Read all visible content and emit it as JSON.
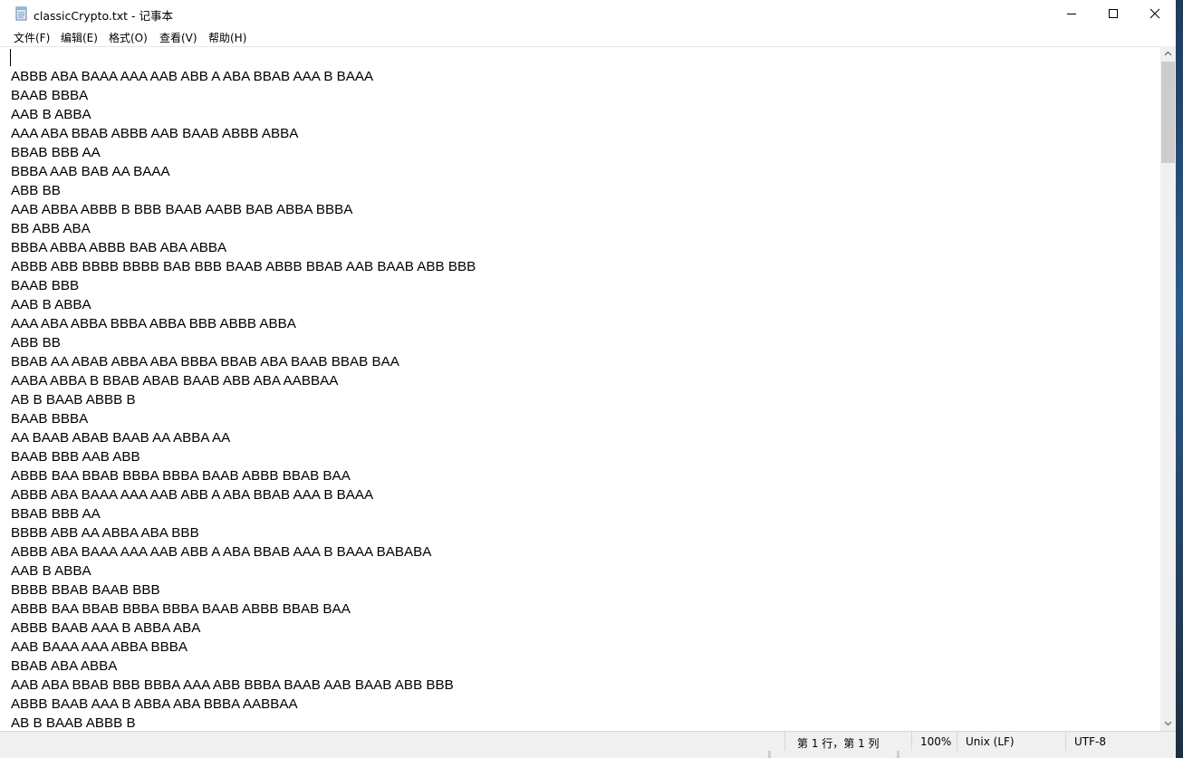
{
  "window": {
    "title": "classicCrypto.txt - 记事本",
    "icon": "notepad-icon"
  },
  "window_controls": {
    "minimize": "minimize-icon",
    "maximize": "maximize-icon",
    "close": "close-icon"
  },
  "menu": {
    "items": [
      {
        "label": "文件(F)"
      },
      {
        "label": "编辑(E)"
      },
      {
        "label": "格式(O)"
      },
      {
        "label": "查看(V)"
      },
      {
        "label": "帮助(H)"
      }
    ]
  },
  "editor": {
    "lines": [
      "ABBB ABA BAAA AAA AAB ABB A ABA BBAB AAA B BAAA",
      "BAAB BBBA",
      "AAB B ABBA",
      "AAA ABA BBAB ABBB AAB BAAB ABBB ABBA",
      "BBAB BBB AA",
      "BBBA AAB BAB AA BAAA",
      "ABB BB",
      "AAB ABBA ABBB B BBB BAAB AABB BAB ABBA BBBA",
      "BB ABB ABA",
      "BBBA ABBA ABBB BAB ABA ABBA",
      "ABBB ABB BBBB BBBB BAB BBB BAAB ABBB BBAB AAB BAAB ABB BBB",
      "BAAB BBB",
      "AAB B ABBA",
      "AAA ABA ABBA BBBA ABBA BBB ABBB ABBA",
      "ABB BB",
      "BBAB AA ABAB ABBA ABA BBBA BBAB ABA BAAB BBAB BAA",
      "AABA ABBA B BBAB ABAB BAAB ABB ABA AABBAA",
      "AB B BAAB ABBB B",
      "BAAB BBBA",
      "AA BAAB ABAB BAAB AA ABBA AA",
      "BAAB BBB AAB ABB",
      "ABBB BAA BBAB BBBA BBBA BAAB ABBB BBAB BAA",
      "ABBB ABA BAAA AAA AAB ABB A ABA BBAB AAA B BAAA",
      "BBAB BBB AA",
      "BBBB ABB AA ABBA ABA BBB",
      "ABBB ABA BAAA AAA AAB ABB A ABA BBAB AAA B BAAA BABABA",
      "AAB B ABBA",
      "BBBB BBAB BAAB BBB",
      "ABBB BAA BBAB BBBA BBBA BAAB ABBB BBAB BAA",
      "ABBB BAAB AAA B ABBA ABA",
      "AAB BAAA AAA ABBA BBBA",
      "BBAB ABA ABBA",
      "AAB ABA BBAB BBB BBBA AAA ABB BBBA BAAB AAB BAAB ABB BBB",
      "ABBB BAAB AAA B ABBA ABA BBBA AABBAA",
      "AB B BAAB ABBB B"
    ]
  },
  "statusbar": {
    "position": "第 1 行，第 1 列",
    "zoom": "100%",
    "line_ending": "Unix (LF)",
    "encoding": "UTF-8"
  },
  "scrollbar": {
    "up": "scroll-up-icon",
    "down": "scroll-down-icon"
  }
}
